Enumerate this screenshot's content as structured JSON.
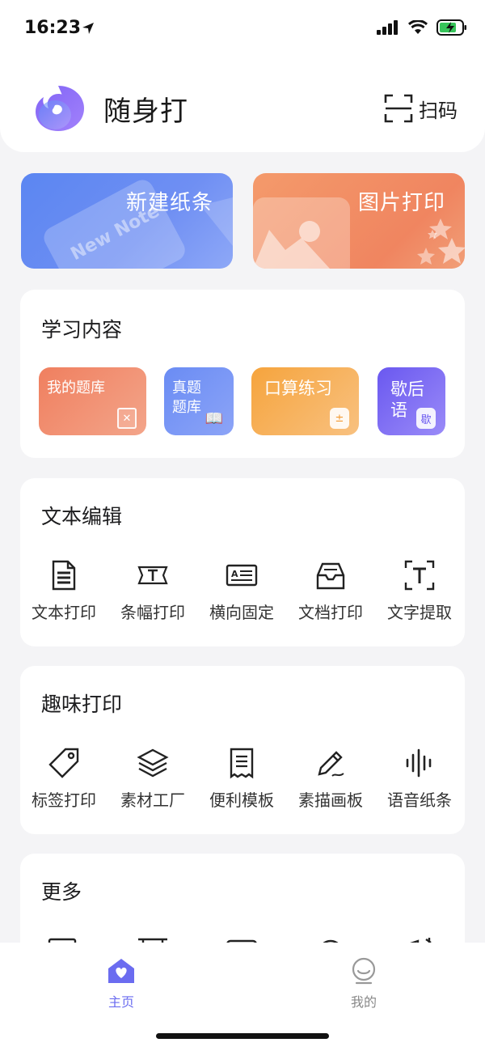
{
  "status_bar": {
    "time": "16:23"
  },
  "header": {
    "app_name": "随身打",
    "scan_label": "扫码"
  },
  "banners": {
    "new_note": "新建纸条",
    "new_note_watermark": "New Note",
    "image_print": "图片打印"
  },
  "study": {
    "title": "学习内容",
    "items": [
      {
        "label": "我的题库",
        "badge": "✕"
      },
      {
        "label": "真题\n题库",
        "badge": "📖"
      },
      {
        "label": "口算练习",
        "badge": "±"
      },
      {
        "label": "歇后\n语",
        "badge": "歇"
      }
    ]
  },
  "text_edit": {
    "title": "文本编辑",
    "items": [
      {
        "label": "文本打印",
        "icon": "document-icon"
      },
      {
        "label": "条幅打印",
        "icon": "banner-icon"
      },
      {
        "label": "横向固定",
        "icon": "landscape-icon"
      },
      {
        "label": "文档打印",
        "icon": "tray-icon"
      },
      {
        "label": "文字提取",
        "icon": "text-extract-icon"
      }
    ]
  },
  "fun_print": {
    "title": "趣味打印",
    "items": [
      {
        "label": "标签打印",
        "icon": "tag-icon"
      },
      {
        "label": "素材工厂",
        "icon": "layers-icon"
      },
      {
        "label": "便利模板",
        "icon": "receipt-icon"
      },
      {
        "label": "素描画板",
        "icon": "pencil-icon"
      },
      {
        "label": "语音纸条",
        "icon": "waveform-icon"
      }
    ]
  },
  "more": {
    "title": "更多"
  },
  "tabbar": {
    "items": [
      {
        "label": "主页",
        "active": true,
        "icon": "home-icon"
      },
      {
        "label": "我的",
        "active": false,
        "icon": "profile-icon"
      }
    ]
  },
  "colors": {
    "accent": "#6b6cf0",
    "note_banner": "#5b86f2",
    "image_banner": "#f08560"
  }
}
